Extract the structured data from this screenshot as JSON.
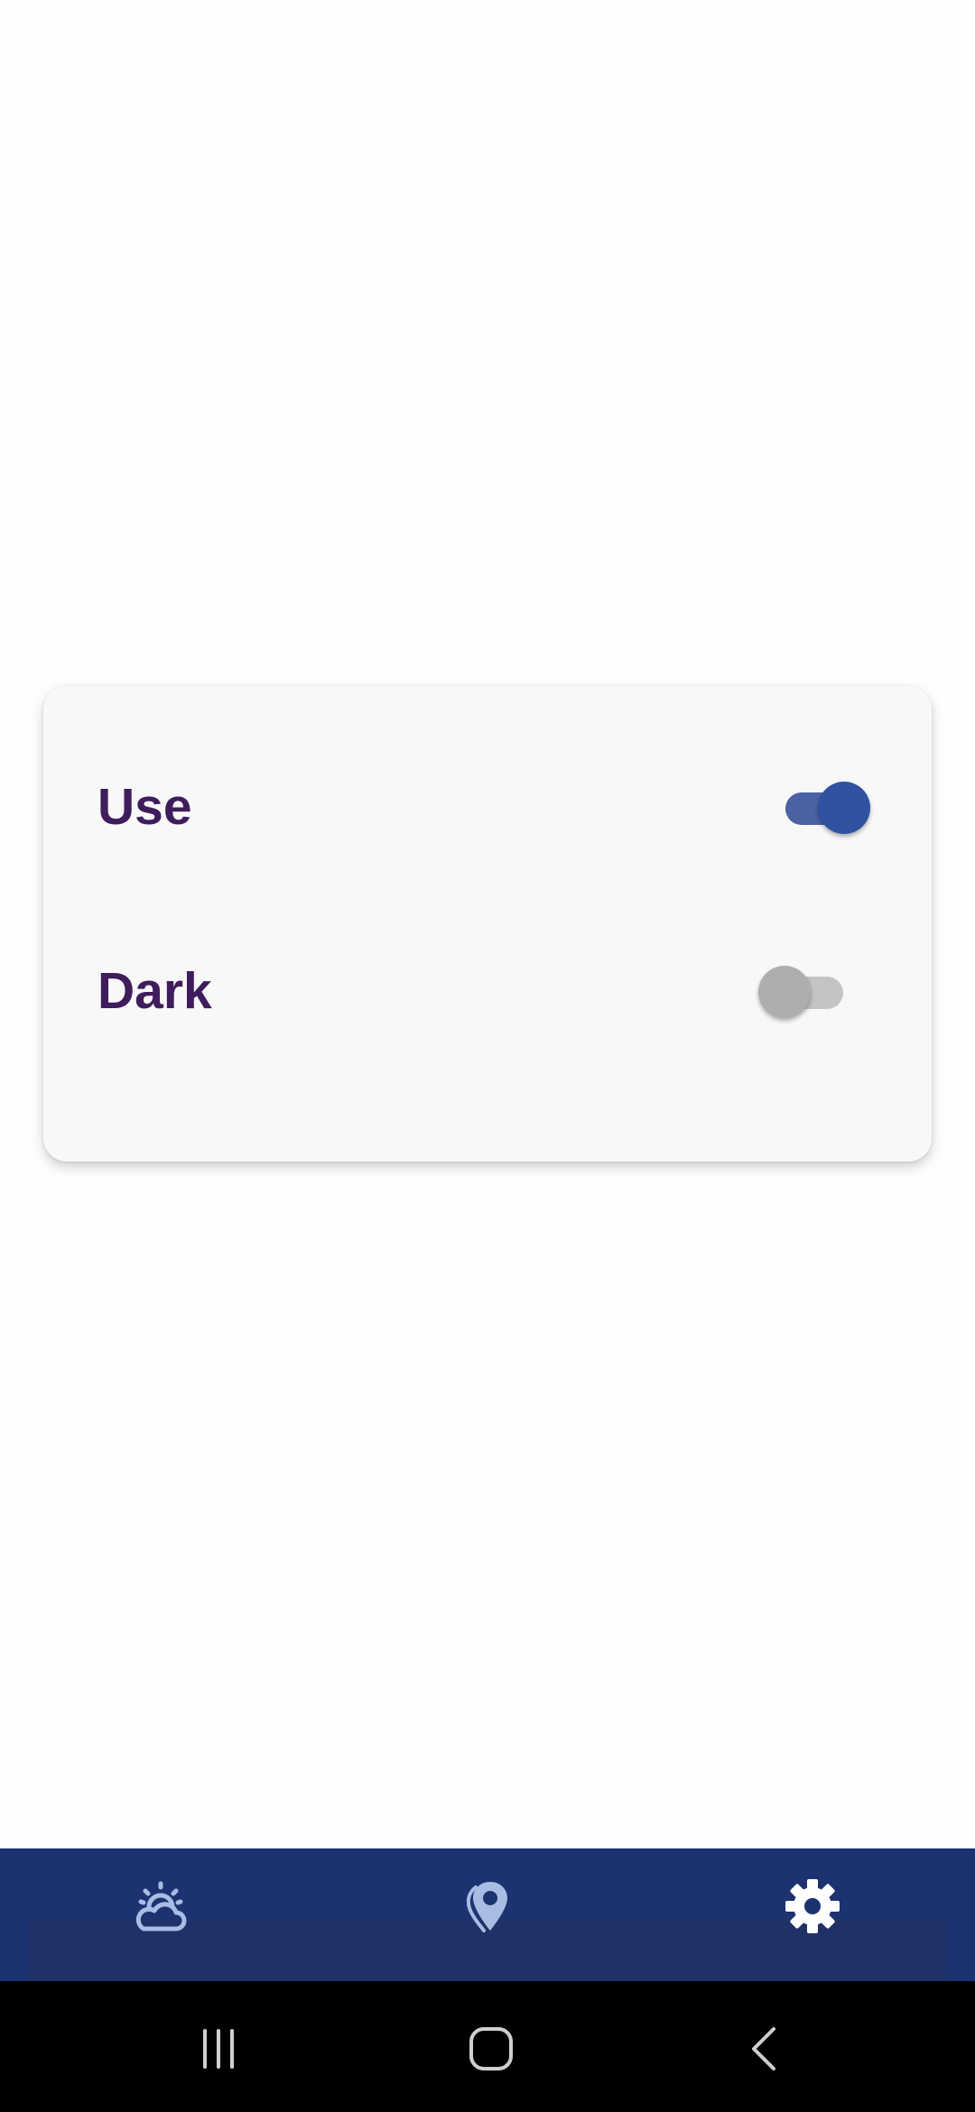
{
  "settings": {
    "use_label": "Use",
    "use_enabled": true,
    "dark_label": "Dark",
    "dark_enabled": false
  },
  "bottom_nav": {
    "items": [
      {
        "icon": "weather-cloud-sun-icon",
        "active": false
      },
      {
        "icon": "location-pin-icon",
        "active": false
      },
      {
        "icon": "gear-icon",
        "active": true
      }
    ]
  },
  "system_nav": {
    "items": [
      "recent-apps-icon",
      "home-icon",
      "back-icon"
    ]
  },
  "colors": {
    "label_text": "#3f1d5c",
    "switch_on": "#3052a0",
    "switch_off": "#aeaeae",
    "nav_background": "#1d3270",
    "nav_icon_inactive": "#a9bce4",
    "nav_icon_active": "#ffffff"
  }
}
